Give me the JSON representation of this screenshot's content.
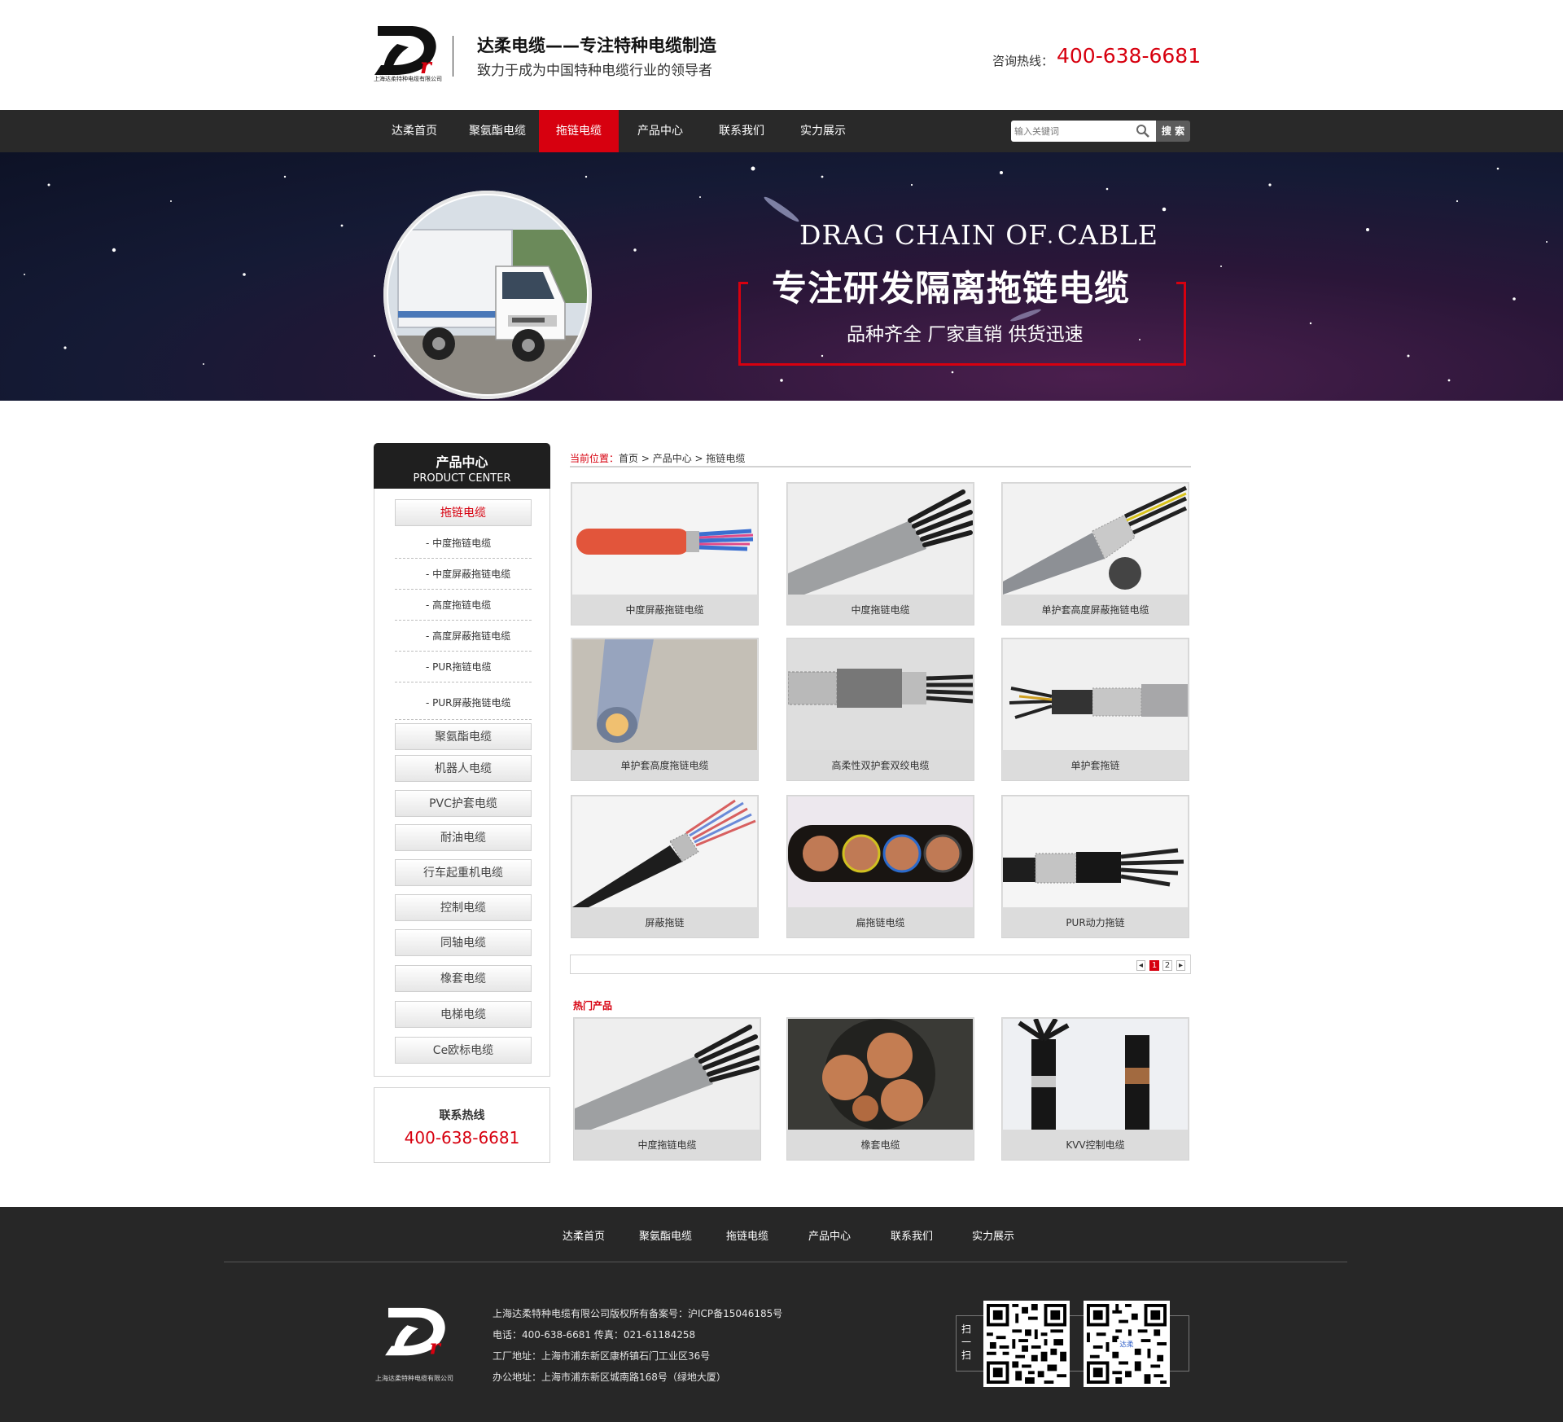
{
  "header": {
    "logo_subtitle": "上海达柔特种电缆有限公司",
    "brand_title": "达柔电缆——专注特种电缆制造",
    "slogan": "致力于成为中国特种电缆行业的领导者",
    "hotline_label": "咨询热线：",
    "hotline_number": "400-638-6681"
  },
  "nav": {
    "items": [
      {
        "label": "达柔首页"
      },
      {
        "label": "聚氨酯电缆"
      },
      {
        "label": "拖链电缆"
      },
      {
        "label": "产品中心"
      },
      {
        "label": "联系我们"
      },
      {
        "label": "实力展示"
      }
    ],
    "active_index": 2,
    "search_placeholder": "输入关键词",
    "search_button": "搜 索"
  },
  "banner": {
    "title_en": "DRAG CHAIN OF CABLE",
    "title_cn": "专注研发隔离拖链电缆",
    "tagline": "品种齐全  厂家直销  供货迅速"
  },
  "sidebar": {
    "title_cn": "产品中心",
    "title_en": "PRODUCT CENTER",
    "active_category": "拖链电缆",
    "sub_items": [
      "- 中度拖链电缆",
      "- 中度屏蔽拖链电缆",
      "- 高度拖链电缆",
      "- 高度屏蔽拖链电缆",
      "- PUR拖链电缆",
      "- PUR屏蔽拖链电缆"
    ],
    "categories": [
      "聚氨酯电缆",
      "机器人电缆",
      "PVC护套电缆",
      "耐油电缆",
      "行车起重机电缆",
      "控制电缆",
      "同轴电缆",
      "橡套电缆",
      "电梯电缆",
      "Ce欧标电缆"
    ],
    "contact_label": "联系热线",
    "contact_number": "400-638-6681"
  },
  "breadcrumb": {
    "label": "当前位置：",
    "home": "首页",
    "sep": " > ",
    "level1": "产品中心",
    "level2": "拖链电缆"
  },
  "products": [
    {
      "name": "中度屏蔽拖链电缆",
      "image": "orange-cable-photo"
    },
    {
      "name": "中度拖链电缆",
      "image": "grey-cable-photo"
    },
    {
      "name": "单护套高度屏蔽拖链电缆",
      "image": "shielded-cable-photo"
    },
    {
      "name": "单护套高度拖链电缆",
      "image": "cable-cross-section-photo"
    },
    {
      "name": "高柔性双护套双绞电缆",
      "image": "braided-cable-photo"
    },
    {
      "name": "单护套拖链",
      "image": "shielded-cable-photo"
    },
    {
      "name": "屏蔽拖链",
      "image": "black-cable-photo"
    },
    {
      "name": "扁拖链电缆",
      "image": "flat-cable-photo"
    },
    {
      "name": "PUR动力拖链",
      "image": "pur-cable-photo"
    }
  ],
  "pager": {
    "prev": "◂",
    "pages": [
      "1",
      "2"
    ],
    "current": "1",
    "next": "▸"
  },
  "hot": {
    "title": "热门产品",
    "items": [
      {
        "name": "中度拖链电缆",
        "image": "grey-cable-photo"
      },
      {
        "name": "橡套电缆",
        "image": "copper-core-photo"
      },
      {
        "name": "KVV控制电缆",
        "image": "kvv-cable-photo"
      }
    ]
  },
  "footer": {
    "nav": [
      "达柔首页",
      "聚氨酯电缆",
      "拖链电缆",
      "产品中心",
      "联系我们",
      "实力展示"
    ],
    "logo_subtitle": "上海达柔特种电缆有限公司",
    "copyright": "上海达柔特种电缆有限公司版权所有备案号：沪ICP备15046185号",
    "phone": "电话：400-638-6681     传真：021-61184258",
    "factory": "工厂地址：上海市浦东新区康桥镇石门工业区36号",
    "office": "办公地址：上海市浦东新区城南路168号（绿地大厦）",
    "scan": "扫一扫",
    "qr_center": "达柔"
  },
  "colors": {
    "accent": "#d7000f",
    "nav_bg": "#292929",
    "footer_bg": "#272727"
  }
}
